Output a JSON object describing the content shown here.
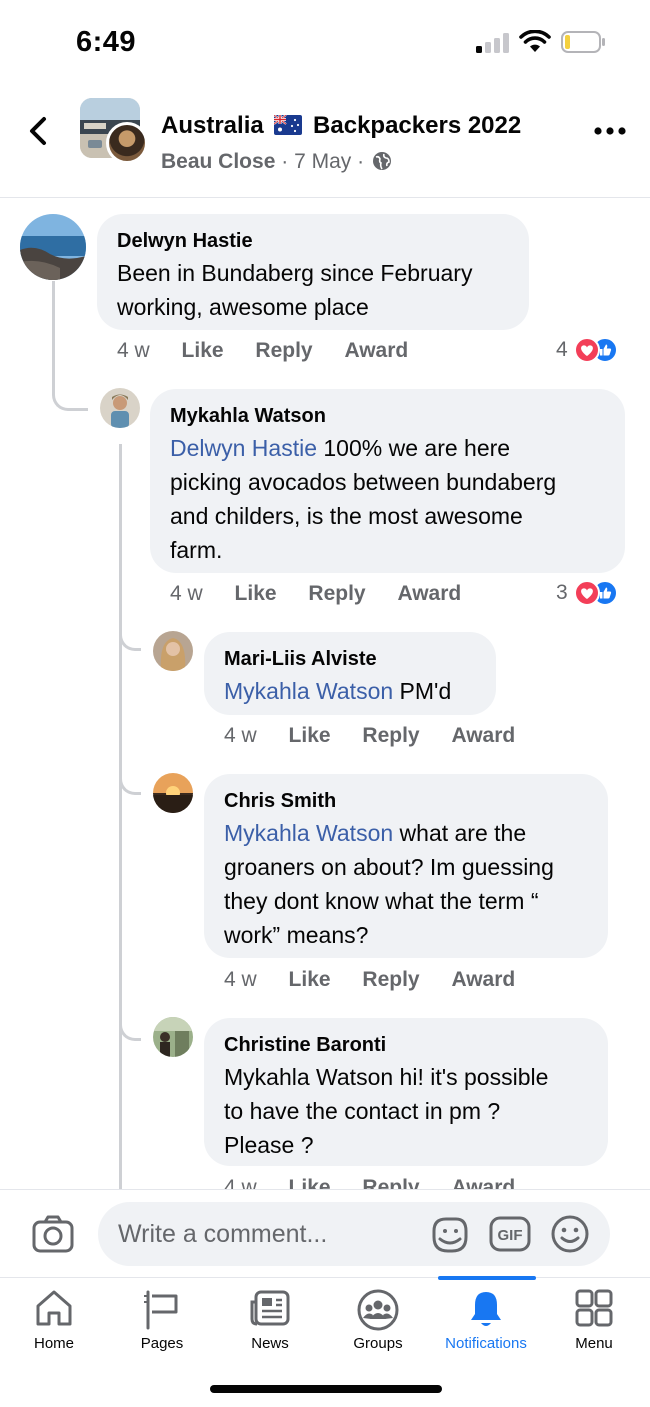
{
  "status_bar": {
    "time": "6:49"
  },
  "header": {
    "group_name": "Australia",
    "group_name_suffix": "Backpackers 2022",
    "author": "Beau Close",
    "date": "7 May",
    "separator": "·"
  },
  "comments": [
    {
      "author": "Delwyn Hastie",
      "mention": "",
      "text": "Been in Bundaberg since February working, awesome place",
      "line1": "Been in Bundaberg since February",
      "line2": "working, awesome place",
      "time": "4 w",
      "reaction_count": "4"
    },
    {
      "author": "Mykahla Watson",
      "mention": "Delwyn Hastie",
      "line1": "100% we are here",
      "line2": "picking avocados between bundaberg",
      "line3": "and childers, is the most awesome",
      "line4": "farm.",
      "time": "4 w",
      "reaction_count": "3"
    },
    {
      "author": "Mari-Liis Alviste",
      "mention": "Mykahla Watson",
      "line1": "PM'd",
      "time": "4 w"
    },
    {
      "author": "Chris Smith",
      "mention": "Mykahla Watson",
      "line1": "what are the",
      "line2": "groaners on about? Im guessing",
      "line3": "they dont know what the term “",
      "line4": "work” means?",
      "time": "4 w"
    },
    {
      "author": "Christine Baronti",
      "line1": "Mykahla Watson hi! it's possible",
      "line2": "to have the contact in pm ?",
      "line3": "Please ?",
      "time": "4 w"
    }
  ],
  "actions": {
    "like": "Like",
    "reply": "Reply",
    "award": "Award"
  },
  "composer": {
    "placeholder": "Write a comment..."
  },
  "nav": [
    {
      "label": "Home",
      "icon": "home-icon"
    },
    {
      "label": "Pages",
      "icon": "flag-icon"
    },
    {
      "label": "News",
      "icon": "news-icon"
    },
    {
      "label": "Groups",
      "icon": "groups-icon"
    },
    {
      "label": "Notifications",
      "icon": "bell-icon",
      "active": true
    },
    {
      "label": "Menu",
      "icon": "menu-grid-icon"
    }
  ],
  "colors": {
    "accent": "#1877f2",
    "mention": "#3b5fa8",
    "bubble": "#f0f2f5",
    "love": "#f33e58"
  }
}
